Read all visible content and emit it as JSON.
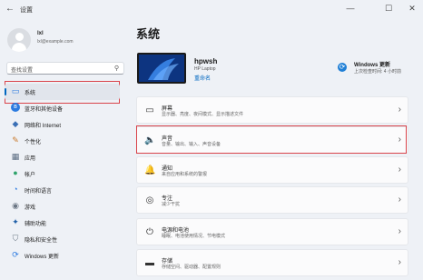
{
  "window": {
    "title": "设置",
    "back": "←",
    "min": "—",
    "max": "☐",
    "close": "✕"
  },
  "user": {
    "name": "lxl",
    "email": "lxl@example.com"
  },
  "search": {
    "placeholder": "查找设置"
  },
  "sidebar": {
    "items": [
      {
        "label": "系统",
        "icon": "display-icon",
        "glyph": "▭"
      },
      {
        "label": "蓝牙和其他设备",
        "icon": "bluetooth-icon",
        "glyph": "ʙ"
      },
      {
        "label": "网络和 Internet",
        "icon": "wifi-icon",
        "glyph": "◆"
      },
      {
        "label": "个性化",
        "icon": "brush-icon",
        "glyph": "✎"
      },
      {
        "label": "应用",
        "icon": "apps-icon",
        "glyph": "▦"
      },
      {
        "label": "帐户",
        "icon": "account-icon",
        "glyph": "●"
      },
      {
        "label": "时间和语言",
        "icon": "clock-globe-icon",
        "glyph": "◔"
      },
      {
        "label": "游戏",
        "icon": "gamepad-icon",
        "glyph": "◉"
      },
      {
        "label": "辅助功能",
        "icon": "accessibility-icon",
        "glyph": "✦"
      },
      {
        "label": "隐私和安全性",
        "icon": "shield-icon",
        "glyph": "⛉"
      },
      {
        "label": "Windows 更新",
        "icon": "update-icon",
        "glyph": "⟳"
      }
    ]
  },
  "main": {
    "title": "系统",
    "device": {
      "name": "hpwsh",
      "model": "HP Laptop",
      "rename": "重命名"
    },
    "windows_update": {
      "title": "Windows 更新",
      "subtitle": "上次检查时间: 4 小时前"
    },
    "cards": [
      {
        "title": "屏幕",
        "subtitle": "显示器、亮度、夜间模式、显示描述文件",
        "icon": "monitor-icon",
        "glyph": "▭"
      },
      {
        "title": "声音",
        "subtitle": "音量、输出、输入、声音设备",
        "icon": "speaker-icon",
        "glyph": "🔈"
      },
      {
        "title": "通知",
        "subtitle": "来自应用和系统的警报",
        "icon": "bell-icon",
        "glyph": "🔔"
      },
      {
        "title": "专注",
        "subtitle": "减少干扰",
        "icon": "focus-icon",
        "glyph": "◎"
      },
      {
        "title": "电源和电池",
        "subtitle": "睡眠、电池使用情况、节电模式",
        "icon": "power-icon",
        "glyph": "⏻"
      },
      {
        "title": "存储",
        "subtitle": "存储空间、驱动器、配置规则",
        "icon": "storage-icon",
        "glyph": "▬"
      }
    ]
  },
  "colors": {
    "accent": "#0067c0",
    "highlight": "#d9434a",
    "background": "#eef1f6"
  }
}
